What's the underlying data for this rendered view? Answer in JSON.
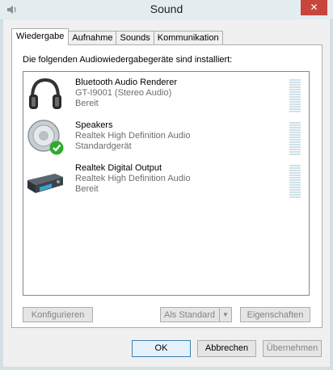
{
  "window": {
    "title": "Sound"
  },
  "tabs": [
    "Wiedergabe",
    "Aufnahme",
    "Sounds",
    "Kommunikation"
  ],
  "panel": {
    "description": "Die folgenden Audiowiedergabegeräte sind installiert:"
  },
  "devices": [
    {
      "name": "Bluetooth Audio Renderer",
      "line2": "GT-I9001 (Stereo Audio)",
      "status": "Bereit",
      "icon": "headphones-icon"
    },
    {
      "name": "Speakers",
      "line2": "Realtek High Definition Audio",
      "status": "Standardgerät",
      "icon": "speaker-icon",
      "is_default": true
    },
    {
      "name": "Realtek Digital Output",
      "line2": "Realtek High Definition Audio",
      "status": "Bereit",
      "icon": "digital-output-icon"
    }
  ],
  "buttons": {
    "configure": "Konfigurieren",
    "set_default": "Als Standard",
    "properties": "Eigenschaften",
    "ok": "OK",
    "cancel": "Abbrechen",
    "apply": "Übernehmen"
  },
  "colors": {
    "close_button": "#c7453a",
    "default_check": "#2eaa2e",
    "meter": "#cfe0e6"
  }
}
